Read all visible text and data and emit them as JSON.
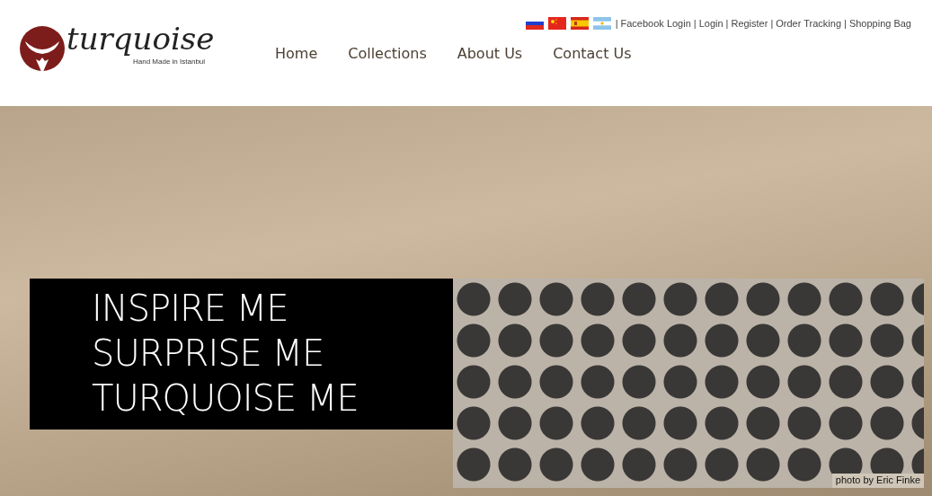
{
  "logo": {
    "name": "turquoise",
    "tagline": "Hand Made in Istanbul"
  },
  "flags": [
    {
      "kind": "russia"
    },
    {
      "kind": "china"
    },
    {
      "kind": "spain"
    },
    {
      "kind": "argentina"
    }
  ],
  "top_links": [
    {
      "separator": "|",
      "label": "Facebook Login"
    },
    {
      "separator": "|",
      "label": "Login"
    },
    {
      "separator": "|",
      "label": "Register"
    },
    {
      "separator": "|",
      "label": "Order Tracking"
    },
    {
      "separator": "|",
      "label": "Shopping Bag"
    }
  ],
  "nav": [
    "Home",
    "Collections",
    "About Us",
    "Contact Us"
  ],
  "hero": {
    "headline": [
      "INSPIRE ME",
      "SURPRISE ME",
      "TURQUOISE ME"
    ],
    "photo_credit": "photo by Eric Finke"
  }
}
